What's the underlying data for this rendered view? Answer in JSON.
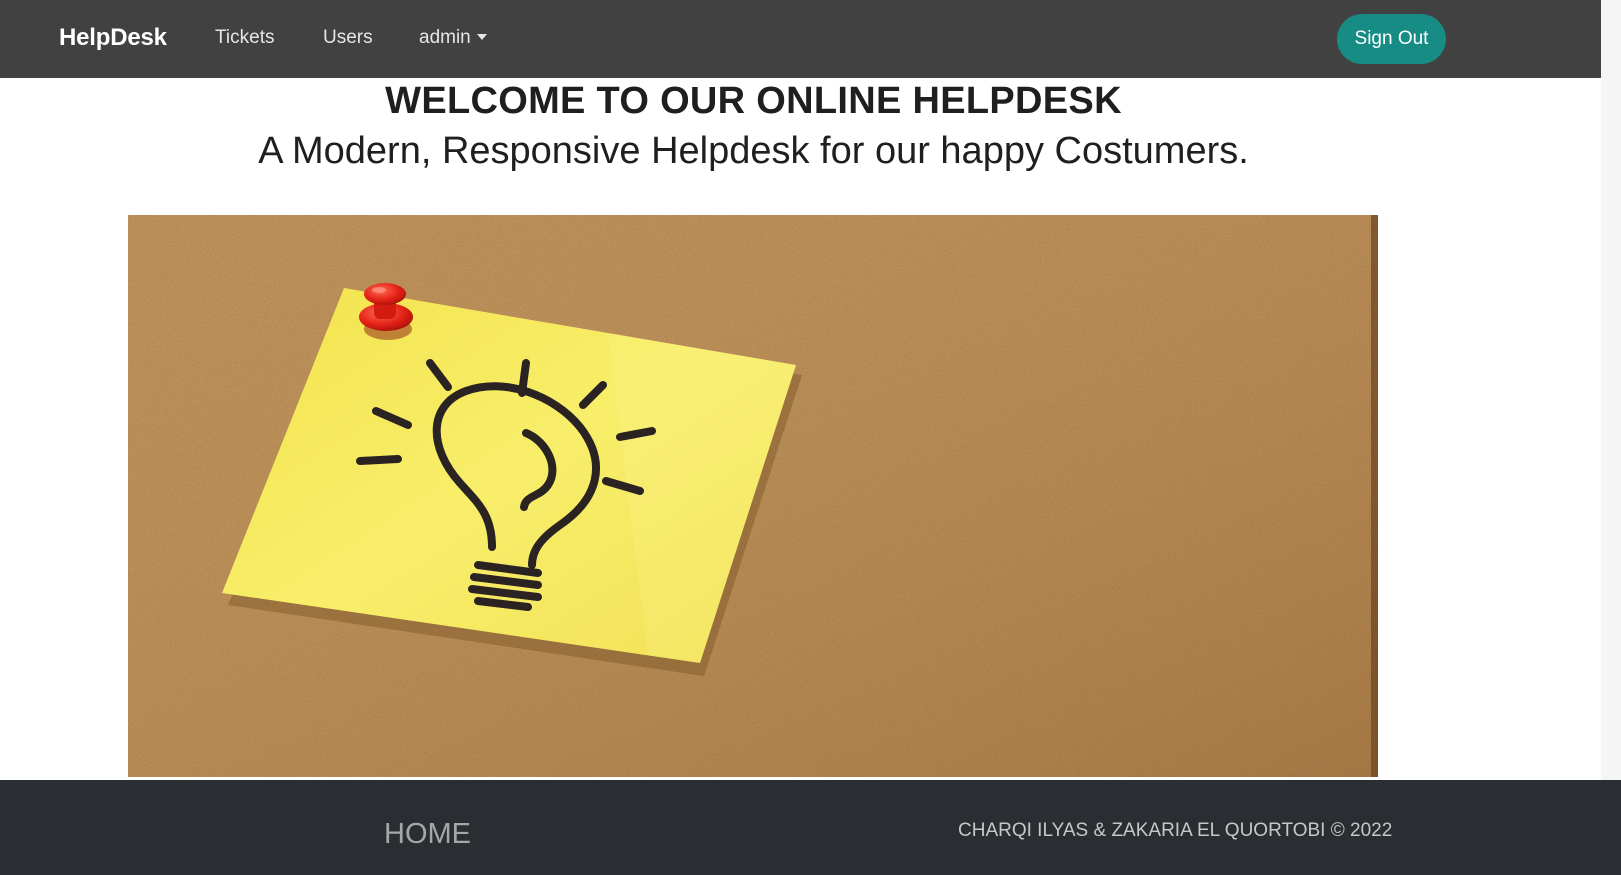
{
  "navbar": {
    "brand": "HelpDesk",
    "links": [
      {
        "label": "Tickets"
      },
      {
        "label": "Users"
      },
      {
        "label": "admin"
      }
    ],
    "sign_out_label": "Sign Out"
  },
  "hero": {
    "title": "WELCOME TO OUR ONLINE HELPDESK",
    "subtitle": "A Modern, Responsive Helpdesk for our happy Costumers."
  },
  "footer": {
    "home_label": "HOME",
    "copyright": "CHARQI ILYAS & ZAKARIA EL QUORTOBI © 2022"
  },
  "colors": {
    "navbar_bg": "#414141",
    "sign_out_bg": "#178c85",
    "footer_bg": "#2a2d31",
    "cork": "#b98547",
    "sticky_note": "#f6ea5a",
    "pin": "#e8231f"
  },
  "icons": {
    "dropdown": "chevron-down-icon",
    "banner": "lightbulb-icon"
  }
}
